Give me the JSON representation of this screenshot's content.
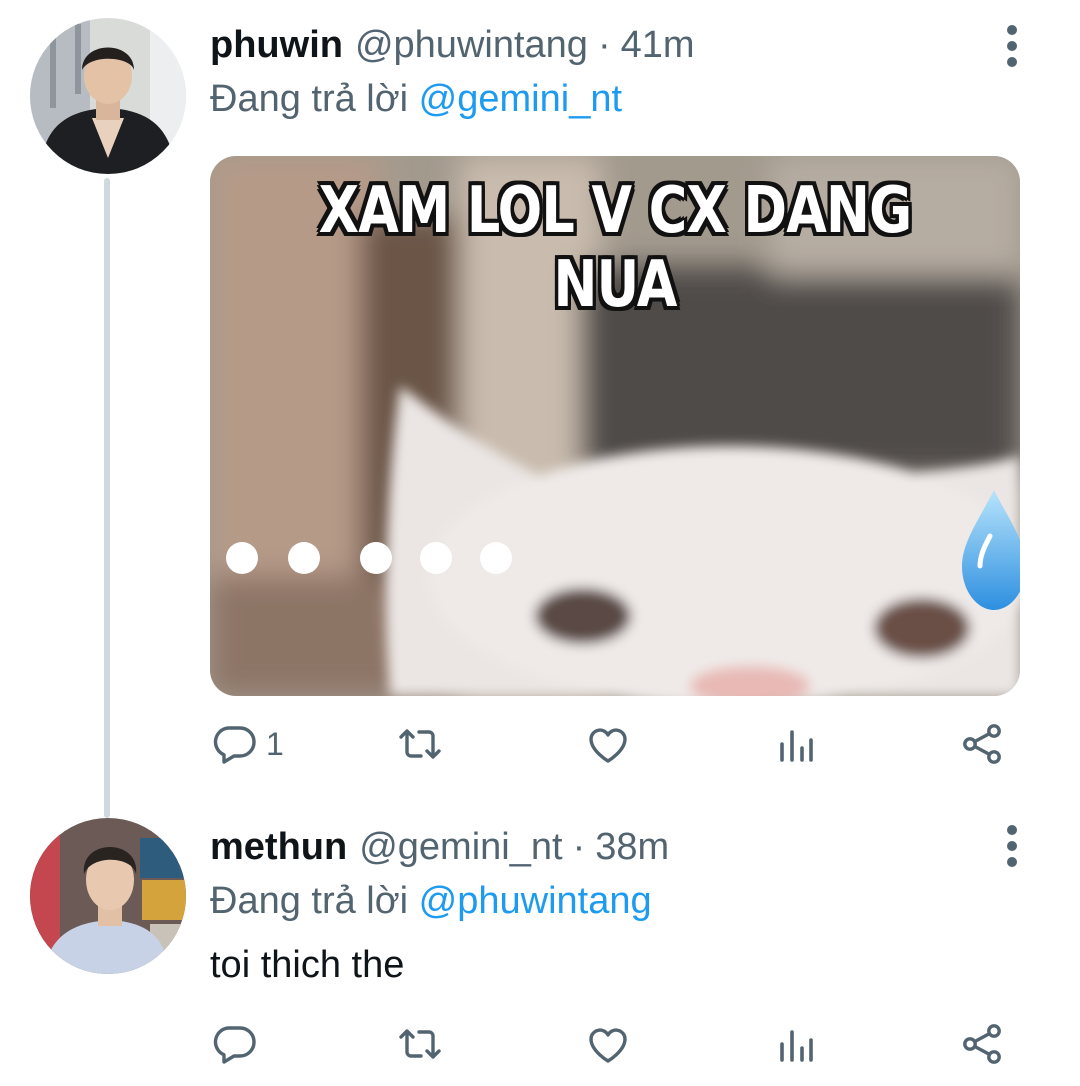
{
  "tweets": [
    {
      "display_name": "phuwin",
      "handle": "@phuwintang",
      "separator": "·",
      "time": "41m",
      "replying_prefix": "Đang trả lời",
      "replying_to": "@gemini_nt",
      "text": "",
      "media_caption": "XAM LOL V CX DANG NUA",
      "actions": {
        "reply_count": "1",
        "icons": [
          "reply-icon",
          "retweet-icon",
          "like-icon",
          "analytics-icon",
          "share-icon"
        ]
      }
    },
    {
      "display_name": "methun",
      "handle": "@gemini_nt",
      "separator": "·",
      "time": "38m",
      "replying_prefix": "Đang trả lời",
      "replying_to": "@phuwintang",
      "text": "toi thich the",
      "actions": {
        "reply_count": "",
        "icons": [
          "reply-icon",
          "retweet-icon",
          "like-icon",
          "analytics-icon",
          "share-icon"
        ]
      }
    }
  ],
  "colors": {
    "text_primary": "#0f1419",
    "text_secondary": "#536471",
    "mention": "#1d9bf0",
    "thread_line": "#cfd9de"
  }
}
